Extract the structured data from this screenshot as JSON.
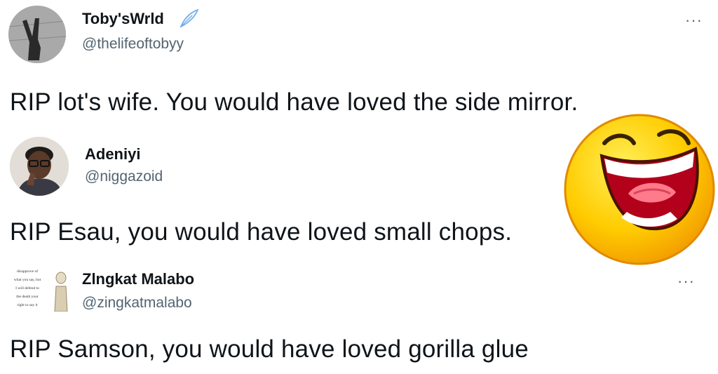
{
  "tweets": [
    {
      "name": "Toby'sWrld",
      "handle": "@thelifeoftobyy",
      "text": "RIP lot's wife. You would have loved the side mirror.",
      "more": "···"
    },
    {
      "name": "Adeniyi",
      "handle": "@niggazoid",
      "text": "RIP Esau, you would have loved small chops.",
      "more": "···"
    },
    {
      "name": "Zlngkat Malabo",
      "handle": "@zingkatmalabo",
      "text": "RIP Samson, you would have loved gorilla glue",
      "more": "···",
      "avatar_text": [
        "disapprove of",
        "what you say, but",
        "I will defend to",
        "the death your",
        "right to say it"
      ]
    }
  ],
  "icons": {
    "name_badge": "feather-icon",
    "overlay": "laughing-emoji-icon"
  },
  "colors": {
    "text": "#0f1419",
    "secondary": "#536471",
    "emoji_yellow": "#ffcc00"
  }
}
